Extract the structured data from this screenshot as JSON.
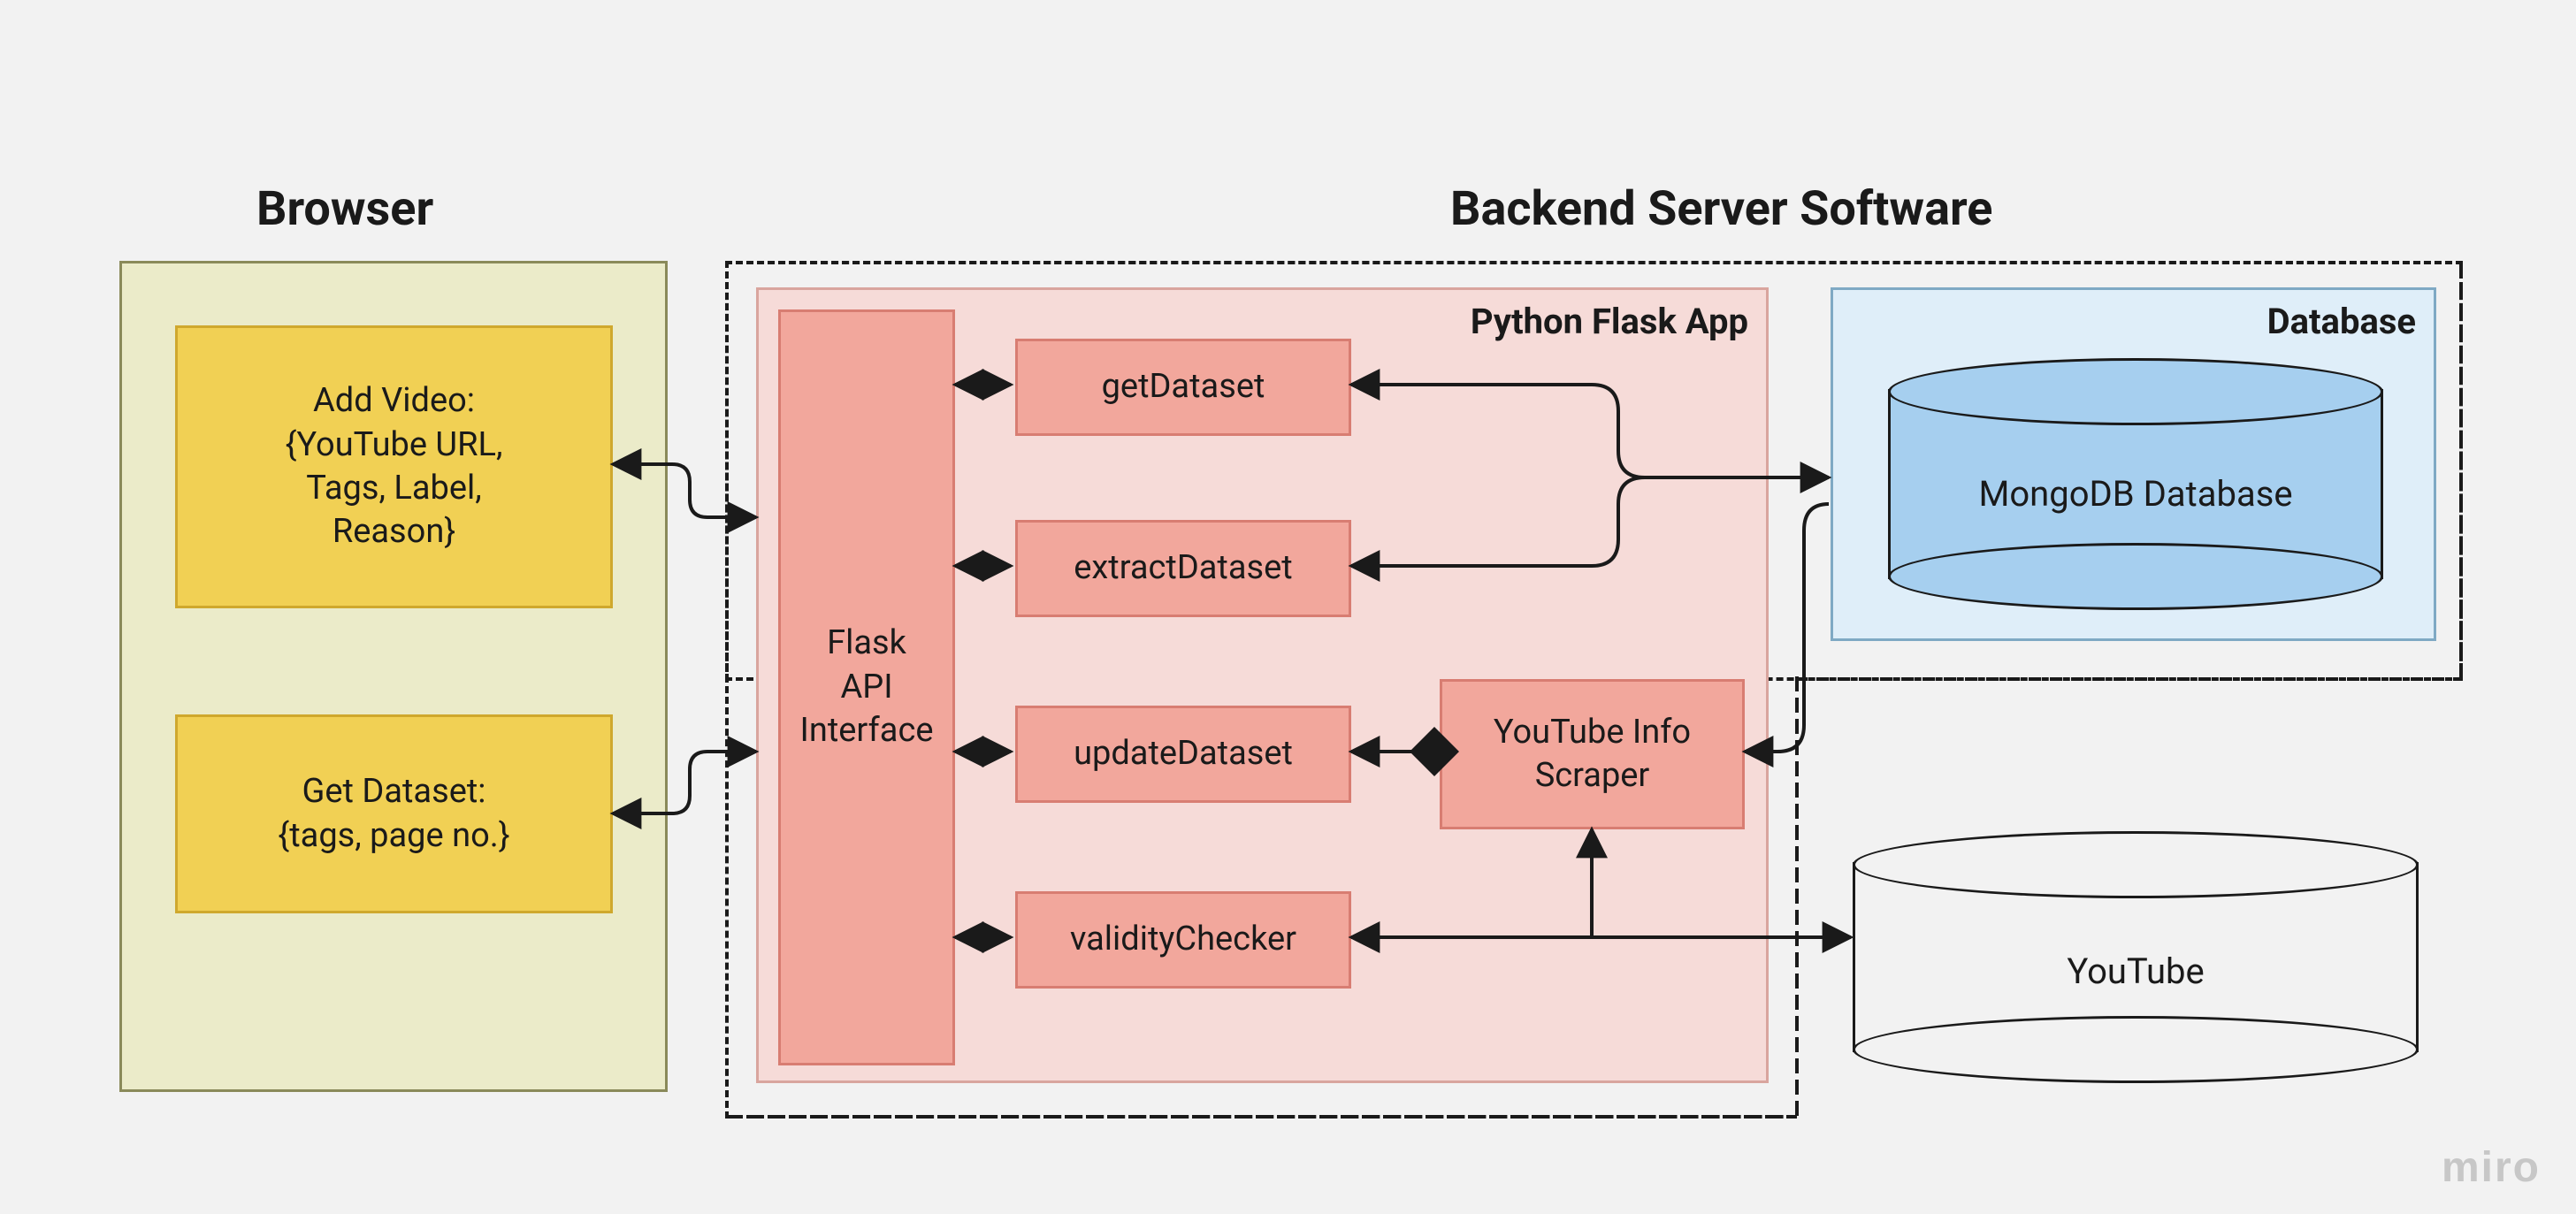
{
  "titles": {
    "browser": "Browser",
    "backend": "Backend Server Software",
    "flask_app": "Python Flask App",
    "database": "Database"
  },
  "browser": {
    "add_video": "Add Video:\n{YouTube URL,\nTags, Label,\nReason}",
    "get_dataset": "Get Dataset:\n{tags, page no.}"
  },
  "flask": {
    "api_interface": "Flask\nAPI\nInterface",
    "get_dataset": "getDataset",
    "extract_dataset": "extractDataset",
    "update_dataset": "updateDataset",
    "validity_checker": "validityChecker",
    "scraper": "YouTube Info\nScraper"
  },
  "db": {
    "mongo": "MongoDB Database",
    "youtube": "YouTube"
  },
  "watermark": "miro",
  "colors": {
    "browser_bg": "#ebebc9",
    "browser_card": "#f1d054",
    "browser_card_border": "#cfa82d",
    "flask_bg": "#f6dbd8",
    "flask_card": "#f2a79c",
    "flask_card_border": "#d87d72",
    "db_bg": "#dfeef9",
    "mongo_fill": "#a6cfef",
    "youtube_fill": "#f2f2f2"
  }
}
